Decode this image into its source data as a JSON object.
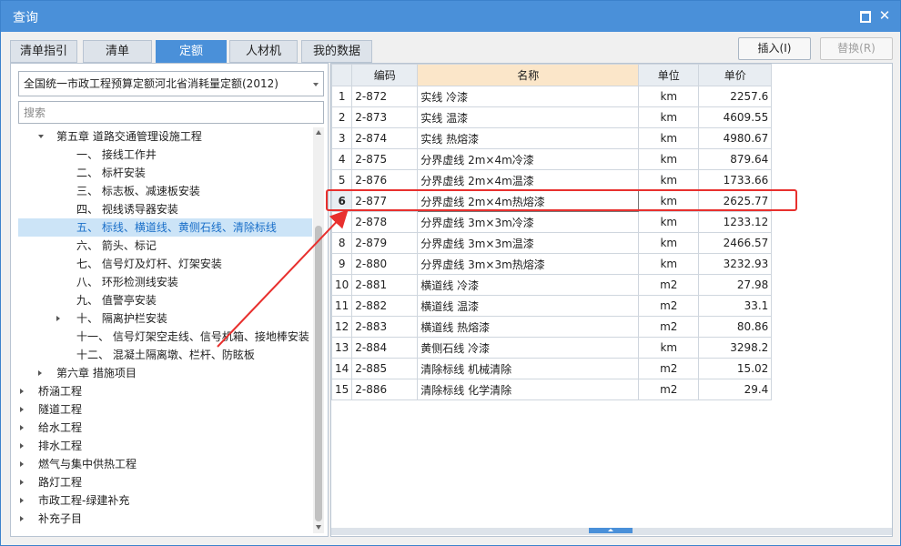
{
  "window": {
    "title": "查询"
  },
  "tabs": [
    {
      "label": "清单指引",
      "active": false
    },
    {
      "label": "清单",
      "active": false
    },
    {
      "label": "定额",
      "active": true
    },
    {
      "label": "人材机",
      "active": false
    },
    {
      "label": "我的数据",
      "active": false
    }
  ],
  "buttons": {
    "insert": "插入(I)",
    "replace": "替换(R)"
  },
  "left": {
    "quota_library": "全国统一市政工程预算定额河北省消耗量定额(2012)",
    "search_placeholder": "搜索",
    "tree": [
      {
        "label": "第五章 道路交通管理设施工程",
        "toggle": "expanded",
        "selected": false
      },
      {
        "label": "一、 接线工作井",
        "toggle": "none",
        "selected": false
      },
      {
        "label": "二、 标杆安装",
        "toggle": "none",
        "selected": false
      },
      {
        "label": "三、 标志板、减速板安装",
        "toggle": "none",
        "selected": false
      },
      {
        "label": "四、 视线诱导器安装",
        "toggle": "none",
        "selected": false
      },
      {
        "label": "五、 标线、横道线、黄侧石线、清除标线",
        "toggle": "none",
        "selected": true
      },
      {
        "label": "六、 箭头、标记",
        "toggle": "none",
        "selected": false
      },
      {
        "label": "七、 信号灯及灯杆、灯架安装",
        "toggle": "none",
        "selected": false
      },
      {
        "label": "八、 环形检测线安装",
        "toggle": "none",
        "selected": false
      },
      {
        "label": "九、 值警亭安装",
        "toggle": "none",
        "selected": false
      },
      {
        "label": "十、 隔离护栏安装",
        "toggle": "collapsed",
        "selected": false
      },
      {
        "label": "十一、 信号灯架空走线、信号机箱、接地棒安装",
        "toggle": "none",
        "selected": false
      },
      {
        "label": "十二、 混凝土隔离墩、栏杆、防眩板",
        "toggle": "none",
        "selected": false
      },
      {
        "label": "第六章 措施项目",
        "toggle": "collapsed",
        "selected": false
      },
      {
        "label": "桥涵工程",
        "toggle": "collapsed",
        "selected": false
      },
      {
        "label": "隧道工程",
        "toggle": "collapsed",
        "selected": false
      },
      {
        "label": "给水工程",
        "toggle": "collapsed",
        "selected": false
      },
      {
        "label": "排水工程",
        "toggle": "collapsed",
        "selected": false
      },
      {
        "label": "燃气与集中供热工程",
        "toggle": "collapsed",
        "selected": false
      },
      {
        "label": "路灯工程",
        "toggle": "collapsed",
        "selected": false
      },
      {
        "label": "市政工程-绿建补充",
        "toggle": "collapsed",
        "selected": false
      },
      {
        "label": "补充子目",
        "toggle": "collapsed",
        "selected": false
      }
    ]
  },
  "table": {
    "headers": {
      "code": "编码",
      "name": "名称",
      "unit": "单位",
      "price": "单价"
    },
    "rows": [
      {
        "idx": "1",
        "code": "2-872",
        "name": "实线 冷漆",
        "unit": "km",
        "price": "2257.6"
      },
      {
        "idx": "2",
        "code": "2-873",
        "name": "实线 温漆",
        "unit": "km",
        "price": "4609.55"
      },
      {
        "idx": "3",
        "code": "2-874",
        "name": "实线 热熔漆",
        "unit": "km",
        "price": "4980.67"
      },
      {
        "idx": "4",
        "code": "2-875",
        "name": "分界虚线 2m×4m冷漆",
        "unit": "km",
        "price": "879.64"
      },
      {
        "idx": "5",
        "code": "2-876",
        "name": "分界虚线 2m×4m温漆",
        "unit": "km",
        "price": "1733.66"
      },
      {
        "idx": "6",
        "code": "2-877",
        "name": "分界虚线 2m×4m热熔漆",
        "unit": "km",
        "price": "2625.77"
      },
      {
        "idx": "7",
        "code": "2-878",
        "name": "分界虚线 3m×3m冷漆",
        "unit": "km",
        "price": "1233.12"
      },
      {
        "idx": "8",
        "code": "2-879",
        "name": "分界虚线 3m×3m温漆",
        "unit": "km",
        "price": "2466.57"
      },
      {
        "idx": "9",
        "code": "2-880",
        "name": "分界虚线 3m×3m热熔漆",
        "unit": "km",
        "price": "3232.93"
      },
      {
        "idx": "10",
        "code": "2-881",
        "name": "横道线 冷漆",
        "unit": "m2",
        "price": "27.98"
      },
      {
        "idx": "11",
        "code": "2-882",
        "name": "横道线 温漆",
        "unit": "m2",
        "price": "33.1"
      },
      {
        "idx": "12",
        "code": "2-883",
        "name": "横道线 热熔漆",
        "unit": "m2",
        "price": "80.86"
      },
      {
        "idx": "13",
        "code": "2-884",
        "name": "黄侧石线 冷漆",
        "unit": "km",
        "price": "3298.2"
      },
      {
        "idx": "14",
        "code": "2-885",
        "name": "清除标线 机械清除",
        "unit": "m2",
        "price": "15.02"
      },
      {
        "idx": "15",
        "code": "2-886",
        "name": "清除标线 化学清除",
        "unit": "m2",
        "price": "29.4"
      }
    ],
    "highlighted_row": 5
  },
  "colors": {
    "accent": "#4a90d9",
    "highlight": "#e8302e",
    "selected_bg": "#cce4f7",
    "name_header": "#fbe6c9"
  }
}
